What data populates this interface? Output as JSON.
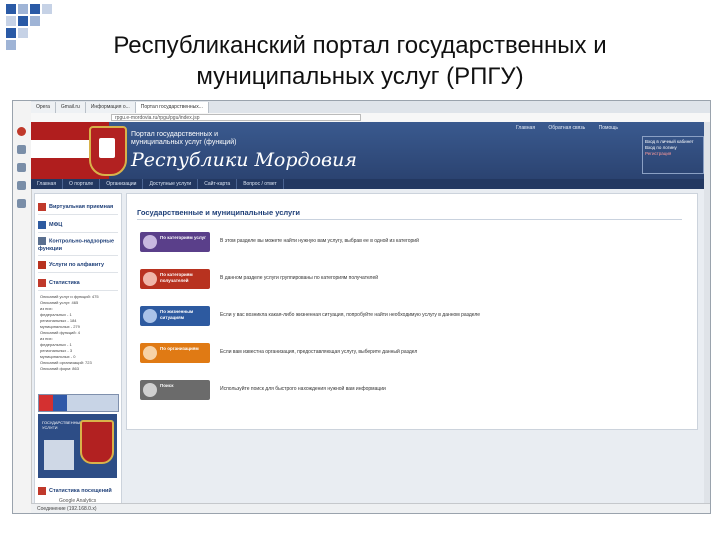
{
  "slide": {
    "title_line1": "Республиканский портал государственных и",
    "title_line2": "муниципальных услуг (РПГУ)"
  },
  "browser": {
    "tabs": [
      "Opera",
      "Gmail.ru",
      "Информация о...",
      "Портал государственных..."
    ],
    "url": "rpgu.e-mordovia.ru/rpgu/pgu/index.jsp",
    "status_text": "Соединение (192.168.0.x)"
  },
  "header": {
    "subtitle": "Портал государственных и муниципальных услуг (функций)",
    "title": "Республики Мордовия",
    "links": [
      "Главная",
      "Обратная связь",
      "Помощь"
    ],
    "login_lines": [
      "Вход в личный кабинет",
      "Вход по логину",
      "Регистрация"
    ]
  },
  "topnav": [
    "Главная",
    "О портале",
    "Организации",
    "Доступные услуги",
    "Сайт-карта",
    "Вопрос / ответ"
  ],
  "sidebar": {
    "items": [
      {
        "label": "Виртуальная приемная",
        "icon": "reception-icon"
      },
      {
        "label": "МФЦ",
        "icon": "mfc-icon"
      },
      {
        "label": "Контрольно-надзорные функции",
        "icon": "control-icon"
      },
      {
        "label": "Услуги по алфавиту",
        "icon": "alphabet-icon"
      },
      {
        "label": "Статистика",
        "icon": "statistics-icon"
      }
    ],
    "stats": [
      "Описаний услуг и функций: 475",
      "Описаний услуг: 465",
      "из них:",
      "федеральных - 1",
      "региональных - 184",
      "муниципальных - 279",
      "Описаний функций: 4",
      "из них:",
      "федеральных - 1",
      "региональных - 3",
      "муниципальных - 0",
      "Описаний организаций: 723",
      "Описаний форм: 863"
    ],
    "stats_visits_label": "Статистика посещений",
    "banner_text": "ГОСУДАРСТВЕННЫЕ УСЛУГИ",
    "ga_label": "Google Analytics"
  },
  "main": {
    "title": "Государственные и муниципальные услуги",
    "services": [
      {
        "label": "По категориям услуг",
        "color": "#5a3f8a",
        "icon": "categories-icon",
        "desc": "В этом разделе вы можете найти нужную вам услугу, выбрав ее в одной из категорий"
      },
      {
        "label": "По категориям получателей",
        "color": "#b8321f",
        "icon": "recipients-icon",
        "desc": "В данном разделе услуги группированы по категориям получателей"
      },
      {
        "label": "По жизненным ситуациям",
        "color": "#2d5aa0",
        "icon": "life-situations-icon",
        "desc": "Если у вас возникла какая-либо жизненная ситуация, попробуйте найти необходимую услугу в данном разделе"
      },
      {
        "label": "По организациям",
        "color": "#e07a14",
        "icon": "organizations-icon",
        "desc": "Если вам известна организация, предоставляющая услугу, выберите данный раздел"
      },
      {
        "label": "Поиск",
        "color": "#6b6b6b",
        "icon": "search-icon",
        "desc": "Используйте поиск для быстрого нахождения нужной вам информации"
      }
    ]
  },
  "colors": {
    "header": "#2f4b7c",
    "nav": "#233861",
    "link": "#1e3f78"
  }
}
